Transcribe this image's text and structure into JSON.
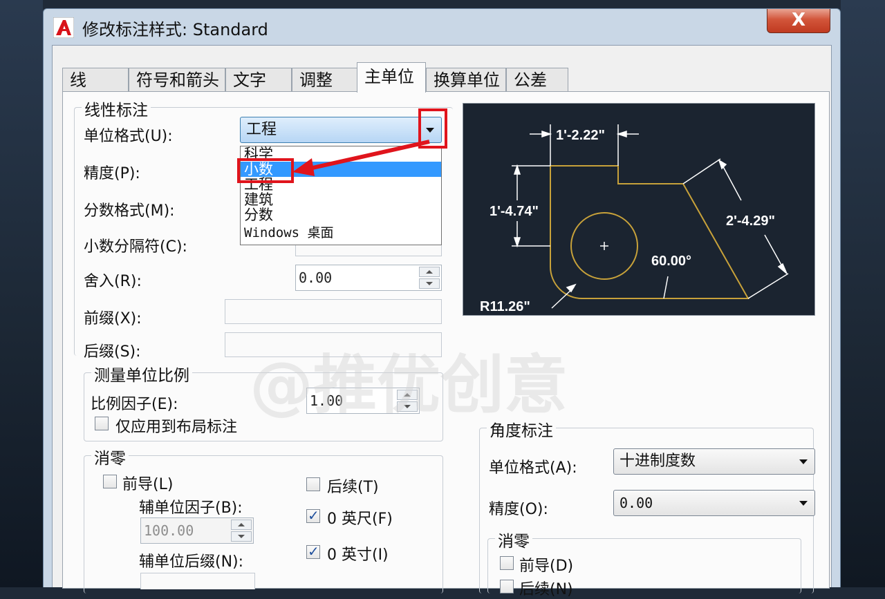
{
  "dialog": {
    "title": "修改标注样式: Standard",
    "close": "X"
  },
  "tabs": [
    {
      "label": "线"
    },
    {
      "label": "符号和箭头"
    },
    {
      "label": "文字"
    },
    {
      "label": "调整"
    },
    {
      "label": "主单位"
    },
    {
      "label": "换算单位"
    },
    {
      "label": "公差"
    }
  ],
  "active_tab": "主单位",
  "linear": {
    "title": "线性标注",
    "unit_format_label": "单位格式(U):",
    "unit_format_value": "工程",
    "precision_label": "精度(P):",
    "fraction_label": "分数格式(M):",
    "decimal_sep_label": "小数分隔符(C):",
    "round_label": "舍入(R):",
    "round_value": "0.00",
    "prefix_label": "前缀(X):",
    "suffix_label": "后缀(S):",
    "dropdown": [
      "科学",
      "小数",
      "工程",
      "建筑",
      "分数",
      "Windows 桌面"
    ],
    "dropdown_selected": "小数"
  },
  "scale": {
    "title": "测量单位比例",
    "factor_label": "比例因子(E):",
    "factor_value": "1.00",
    "layout_only": "仅应用到布局标注"
  },
  "zero": {
    "title": "消零",
    "leading": "前导(L)",
    "sub_factor_label": "辅单位因子(B):",
    "sub_factor_value": "100.00",
    "sub_suffix_label": "辅单位后缀(N):",
    "trailing": "后续(T)",
    "feet": "0 英尺(F)",
    "inches": "0 英寸(I)"
  },
  "angular": {
    "title": "角度标注",
    "unit_format_label": "单位格式(A):",
    "unit_format_value": "十进制度数",
    "precision_label": "精度(O):",
    "precision_value": "0.00",
    "zero_title": "消零",
    "leading": "前导(D)",
    "trailing": "后续(N)"
  },
  "preview": {
    "dim_top": "1'-2.22\"",
    "dim_left": "1'-4.74\"",
    "dim_right": "2'-4.29\"",
    "dim_angle": "60.00°",
    "dim_radius": "R11.26\""
  },
  "watermark": "@推优创意",
  "colors": {
    "highlight": "#3399ff",
    "annotation": "#e0141c",
    "geometry": "#c8a23a"
  }
}
